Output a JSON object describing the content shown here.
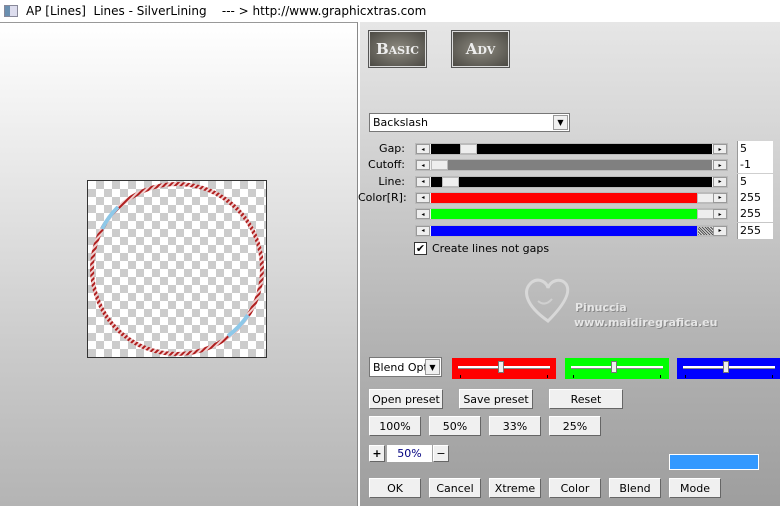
{
  "window": {
    "title": "AP [Lines]  Lines - SilverLining    --- > http://www.graphicxtras.com"
  },
  "tabs": {
    "basic": "Basic",
    "adv": "Adv"
  },
  "pattern_select": {
    "value": "Backslash"
  },
  "sliders": [
    {
      "label": "Gap:",
      "value": "5",
      "fill": "#000000",
      "position": 0.11
    },
    {
      "label": "Cutoff:",
      "value": "-1",
      "fill": "#808080",
      "position": 0.0
    },
    {
      "label": "Line:",
      "value": "5",
      "fill": "#000000",
      "position": 0.04
    },
    {
      "label": "Color[R]:",
      "value": "255",
      "fill": "#ff0000",
      "position": 1.0
    },
    {
      "label": "",
      "value": "255",
      "fill": "#00ff00",
      "position": 1.0
    },
    {
      "label": "",
      "value": "255",
      "fill": "#0000ff",
      "position": 1.0
    }
  ],
  "checkbox": {
    "label": "Create lines not gaps",
    "checked": true
  },
  "watermark": {
    "name": "Pinuccia",
    "url": "www.maidiregrafica.eu"
  },
  "blend_select": {
    "value": "Blend Opti"
  },
  "color_sliders": [
    {
      "color": "#ff0000",
      "position": 0.5
    },
    {
      "color": "#00ff00",
      "position": 0.5
    },
    {
      "color": "#0000ff",
      "position": 0.5
    }
  ],
  "buttons": {
    "open_preset": "Open preset",
    "save_preset": "Save preset",
    "reset": "Reset",
    "zoom100": "100%",
    "zoom50": "50%",
    "zoom33": "33%",
    "zoom25": "25%",
    "ok": "OK",
    "cancel": "Cancel",
    "xtreme": "Xtreme",
    "color": "Color",
    "blend": "Blend",
    "mode": "Mode"
  },
  "zoom": {
    "plus": "+",
    "value": "50%",
    "minus": "−"
  },
  "color_swatch": "#3399ff",
  "preview": {
    "ring_color": "#b02020",
    "highlight_color": "#8ec8e8"
  }
}
